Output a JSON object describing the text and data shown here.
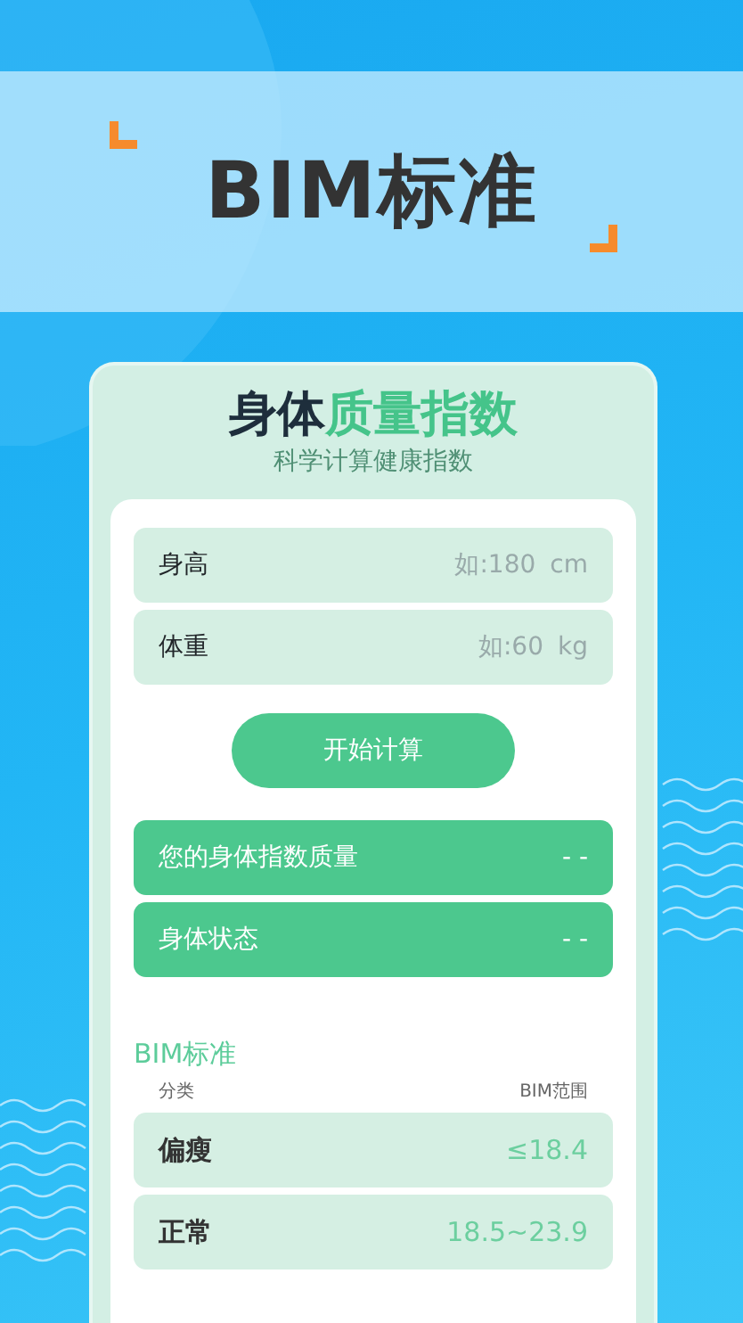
{
  "banner": {
    "title": "BIM标准"
  },
  "card": {
    "title_plain": "身体",
    "title_highlight": "质量指数",
    "subtitle": "科学计算健康指数"
  },
  "fields": [
    {
      "label": "身高",
      "placeholder": "如:180",
      "unit": "cm"
    },
    {
      "label": "体重",
      "placeholder": "如:60",
      "unit": "kg"
    }
  ],
  "calculate_button": "开始计算",
  "results": [
    {
      "label": "您的身体指数质量",
      "value": "- -"
    },
    {
      "label": "身体状态",
      "value": "- -"
    }
  ],
  "standard": {
    "title": "BIM标准",
    "column_1": "分类",
    "column_2": "BIM范围",
    "rows": [
      {
        "category": "偏瘦",
        "range": "≤18.4"
      },
      {
        "category": "正常",
        "range": "18.5~23.9"
      }
    ]
  }
}
